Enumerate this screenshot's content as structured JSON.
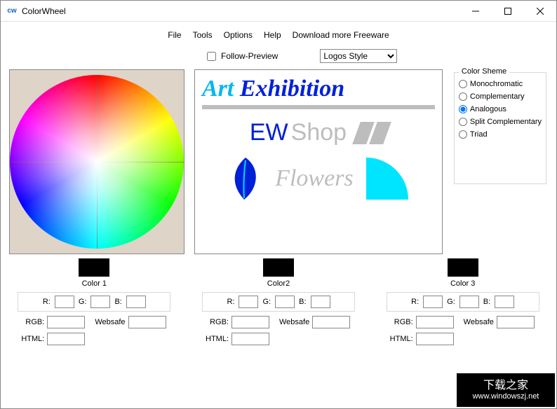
{
  "window": {
    "title": "ColorWheel",
    "icon_letters": "cw"
  },
  "menu": {
    "file": "File",
    "tools": "Tools",
    "options": "Options",
    "help": "Help",
    "download": "Download more Freeware"
  },
  "follow_preview": {
    "label": "Follow-Preview",
    "checked": false,
    "style_select": "Logos Style"
  },
  "preview": {
    "art": "Art",
    "exhibition": "Exhibition",
    "ew": "EW",
    "shop": "Shop",
    "flowers": "Flowers"
  },
  "scheme": {
    "legend": "Color Sheme",
    "options": {
      "mono": "Monochromatic",
      "comp": "Complementary",
      "analog": "Analogous",
      "split": "Split Complementary",
      "triad": "Triad"
    },
    "selected": "analog"
  },
  "color_panels": [
    {
      "name": "Color 1",
      "swatch": "#000000",
      "R": "",
      "G": "",
      "B": "",
      "RGB": "",
      "Websafe": "",
      "HTML": ""
    },
    {
      "name": "Color2",
      "swatch": "#000000",
      "R": "",
      "G": "",
      "B": "",
      "RGB": "",
      "Websafe": "",
      "HTML": ""
    },
    {
      "name": "Color 3",
      "swatch": "#000000",
      "R": "",
      "G": "",
      "B": "",
      "RGB": "",
      "Websafe": "",
      "HTML": ""
    }
  ],
  "labels": {
    "R": "R:",
    "G": "G:",
    "B": "B:",
    "RGB": "RGB:",
    "Websafe": "Websafe",
    "HTML": "HTML:"
  },
  "watermark": {
    "line1": "下载之家",
    "url": "www.windowszj.net"
  }
}
